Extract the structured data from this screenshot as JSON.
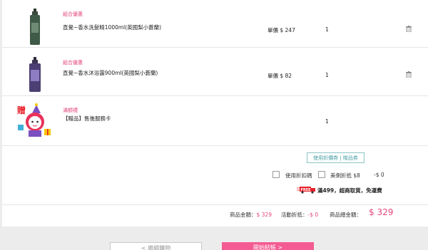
{
  "items": [
    {
      "tag": "組合優惠",
      "name": "直覺~香水洗髮精1000ml(英國梨小蒼蘭)",
      "price": "單價 $ 247",
      "qty": "1",
      "icon": "shampoo-bottle-dark-green"
    },
    {
      "tag": "組合優惠",
      "name": "直覺~香水沐浴露900ml(英國梨小蒼蘭)",
      "price": "單價 $ 82",
      "qty": "1",
      "icon": "bodywash-bottle-purple"
    },
    {
      "tag": "滿額禮",
      "name": "【贈品】售後服務卡",
      "qty": "1",
      "icon": "gift-mascot"
    }
  ],
  "gift_badge_text": "贈",
  "coupon_button": "使用折價券 | 贈品券",
  "discount_code_label": "使用折扣碼",
  "beauty_label": "美側折抵 $8",
  "beauty_value": "-$ 0",
  "free_badge": "FREE",
  "shipping_note": "滿499，超商取貨，免運費",
  "totals": {
    "subtotal_label": "商品金額：",
    "subtotal_value": "$ 329",
    "discount_label": "活動折抵：",
    "discount_value": "-$ 0",
    "grand_label": "商品總金額：",
    "grand_value": "$ 329"
  },
  "buttons": {
    "back": "< 繼續購物",
    "checkout": "開始結帳 >"
  },
  "colors": {
    "accent_pink": "#e5477a",
    "checkout_pink": "#f45b92",
    "teal": "#4a9fa3"
  }
}
